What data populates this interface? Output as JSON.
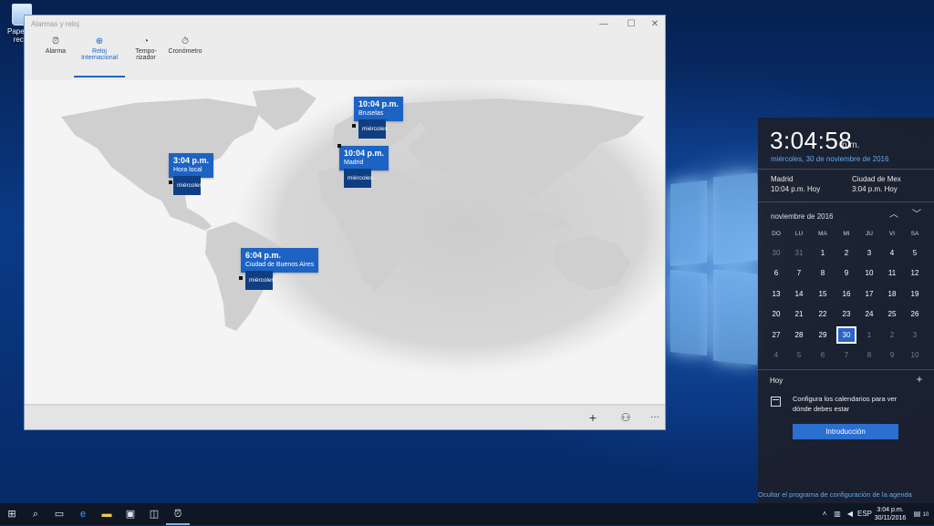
{
  "desktop": {
    "icon_label_line1": "Papelera",
    "icon_label_line2": "recicl"
  },
  "app": {
    "title": "Alarmas y reloj",
    "controls": {
      "minimize": "—",
      "maximize": "☐",
      "close": "✕"
    },
    "tabs": [
      {
        "label": "Alarma",
        "icon": "alarm-clock-icon"
      },
      {
        "label": "Reloj Internacional",
        "icon": "world-clock-icon"
      },
      {
        "label_line1": "Tempo-",
        "label_line2": "rizador",
        "icon": "timer-icon"
      },
      {
        "label": "Cronómetro",
        "icon": "stopwatch-icon"
      }
    ],
    "active_tab": "Reloj Internacional",
    "cities": [
      {
        "time": "10:04 p.m.",
        "name": "Bruselas",
        "day": "miércoles"
      },
      {
        "time": "3:04 p.m.",
        "name": "Hora local",
        "day": "miércoles"
      },
      {
        "time": "10:04 p.m.",
        "name": "Madrid",
        "day": "miércoles"
      },
      {
        "time": "6:04 p.m.",
        "name": "Ciudad de Buenos Aires",
        "day": "miércoles"
      }
    ],
    "bottom": {
      "add": "+",
      "compare": "⚇",
      "more": "···"
    }
  },
  "flyout": {
    "time": "3:04:58",
    "ampm": "p.m.",
    "date": "miércoles, 30 de noviembre de 2016",
    "zones": [
      {
        "city": "Madrid",
        "time": "10:04 p.m. Hoy"
      },
      {
        "city": "Ciudad de Mex",
        "time": "3:04 p.m. Hoy"
      }
    ],
    "month": "noviembre de 2016",
    "weekdays": [
      "DO",
      "LU",
      "MA",
      "MI",
      "JU",
      "VI",
      "SA"
    ],
    "weeks": [
      [
        "30",
        "31",
        "1",
        "2",
        "3",
        "4",
        "5"
      ],
      [
        "6",
        "7",
        "8",
        "9",
        "10",
        "11",
        "12"
      ],
      [
        "13",
        "14",
        "15",
        "16",
        "17",
        "18",
        "19"
      ],
      [
        "20",
        "21",
        "22",
        "23",
        "24",
        "25",
        "26"
      ],
      [
        "27",
        "28",
        "29",
        "30",
        "1",
        "2",
        "3"
      ],
      [
        "4",
        "5",
        "6",
        "7",
        "8",
        "9",
        "10"
      ]
    ],
    "today": "30",
    "hoy": "Hoy",
    "agenda_message": "Configura los calendarios para ver dónde debes estar",
    "intro_button": "Introducción",
    "hide_link": "Ocultar el programa de configuración de la agenda"
  },
  "taskbar": {
    "language": "ESP",
    "clock_time": "3:04 p.m.",
    "clock_date": "30/11/2016",
    "notifications": "10"
  }
}
